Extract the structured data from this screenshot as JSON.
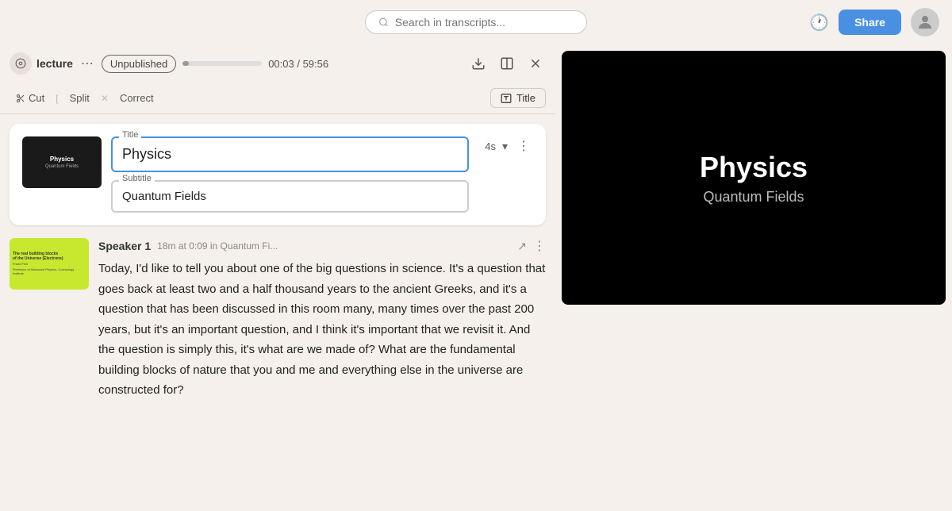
{
  "topbar": {
    "search_placeholder": "Search in transcripts...",
    "share_label": "Share",
    "time_icon": "🕐"
  },
  "toolbar": {
    "lecture_label": "lecture",
    "status_label": "Unpublished",
    "time_current": "00:03",
    "time_total": "59:56",
    "time_display": "00:03 / 59:56"
  },
  "edit_tools": {
    "cut_label": "Cut",
    "split_label": "Split",
    "correct_label": "Correct",
    "title_label": "Title"
  },
  "title_card": {
    "slide_title": "Physics",
    "slide_subtitle": "Quantum Fields",
    "title_field_label": "Title",
    "title_value": "Physics",
    "subtitle_field_label": "Subtitle",
    "subtitle_value": "Quantum Fields",
    "duration": "4s"
  },
  "speaker_segment": {
    "speaker_name": "Speaker 1",
    "meta": "18m at 0:09 in Quantum Fi...",
    "thumb_line1": "The real building blocks",
    "thumb_line2": "of the Universe (Electrons)",
    "thumb_line3": "Frank Finn",
    "thumb_line4": "Professor of Advanced Physics, Cosmology Institute",
    "text": "Today, I'd like to tell you about one of the big questions in science. It's a question that goes back at least two and a half thousand years to the ancient Greeks, and it's a question that has been discussed in this room many, many times over the past 200 years, but it's an important question, and I think it's important that we revisit it. And the question is simply this, it's what are we made of? What are the fundamental building blocks of nature that you and me and everything else in the universe are constructed for?"
  },
  "preview": {
    "title": "Physics",
    "subtitle": "Quantum Fields"
  }
}
